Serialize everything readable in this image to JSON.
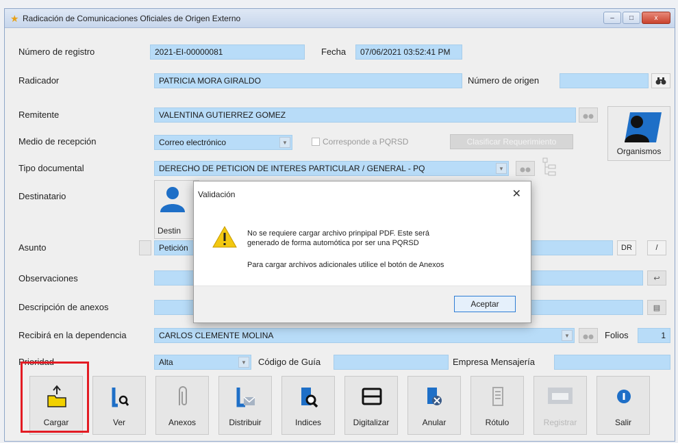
{
  "window": {
    "title": "Radicación de Comunicaciones Oficiales de Origen Externo",
    "controls": [
      "–",
      "□",
      "x"
    ]
  },
  "form": {
    "numero_registro_label": "Número de registro",
    "numero_registro_value": "2021-EI-00000081",
    "fecha_label": "Fecha",
    "fecha_value": "07/06/2021 03:52:41 PM",
    "radicador_label": "Radicador",
    "radicador_value": "PATRICIA MORA GIRALDO",
    "numero_origen_label": "Número de origen",
    "numero_origen_value": "",
    "remitente_label": "Remitente",
    "remitente_value": "VALENTINA GUTIERREZ GOMEZ",
    "medio_label": "Medio de recepción",
    "medio_value": "Correo electrónico",
    "pqrsd_label": "Corresponde a PQRSD",
    "clasificar_label": "Clasificar Requerimiento",
    "tipo_doc_label": "Tipo documental",
    "tipo_doc_value": "DERECHO DE PETICION DE INTERES PARTICULAR / GENERAL - PQ",
    "destinatario_label": "Destinatario",
    "destinatario_btn": "Destin",
    "asunto_label": "Asunto",
    "asunto_value": "Petición",
    "dr_label": "DR",
    "observaciones_label": "Observaciones",
    "descripcion_label": "Descripción de anexos",
    "recibira_label": "Recibirá en la dependencia",
    "recibira_value": "CARLOS CLEMENTE MOLINA",
    "folios_label": "Folios",
    "folios_value": "1",
    "prioridad_label": "Prioridad",
    "prioridad_value": "Alta",
    "codigo_guia_label": "Código de Guía",
    "empresa_label": "Empresa Mensajería",
    "organismos_label": "Organismos"
  },
  "toolbar": [
    {
      "label": "Cargar",
      "icon": "upload-folder-icon",
      "enabled": true
    },
    {
      "label": "Ver",
      "icon": "view-document-icon",
      "enabled": true
    },
    {
      "label": "Anexos",
      "icon": "paperclip-icon",
      "enabled": true
    },
    {
      "label": "Distribuir",
      "icon": "distribute-icon",
      "enabled": true
    },
    {
      "label": "Indices",
      "icon": "index-search-icon",
      "enabled": true
    },
    {
      "label": "Digitalizar",
      "icon": "scanner-icon",
      "enabled": true
    },
    {
      "label": "Anular",
      "icon": "cancel-document-icon",
      "enabled": true
    },
    {
      "label": "Rótulo",
      "icon": "label-icon",
      "enabled": true
    },
    {
      "label": "Registrar",
      "icon": "register-icon",
      "enabled": false
    },
    {
      "label": "Salir",
      "icon": "exit-icon",
      "enabled": true
    }
  ],
  "dialog": {
    "title": "Validación",
    "line1": "No se requiere cargar archivo prinpipal PDF. Este será",
    "line2": "generado de forma automótica por ser una PQRSD",
    "line3": "Para cargar archivos adicionales utilice el botón de Anexos",
    "ok_label": "Aceptar",
    "close_symbol": "✕"
  },
  "colors": {
    "field_bg": "#b8dcf8",
    "highlight": "#e31b23",
    "accent": "#2d7cd3"
  }
}
